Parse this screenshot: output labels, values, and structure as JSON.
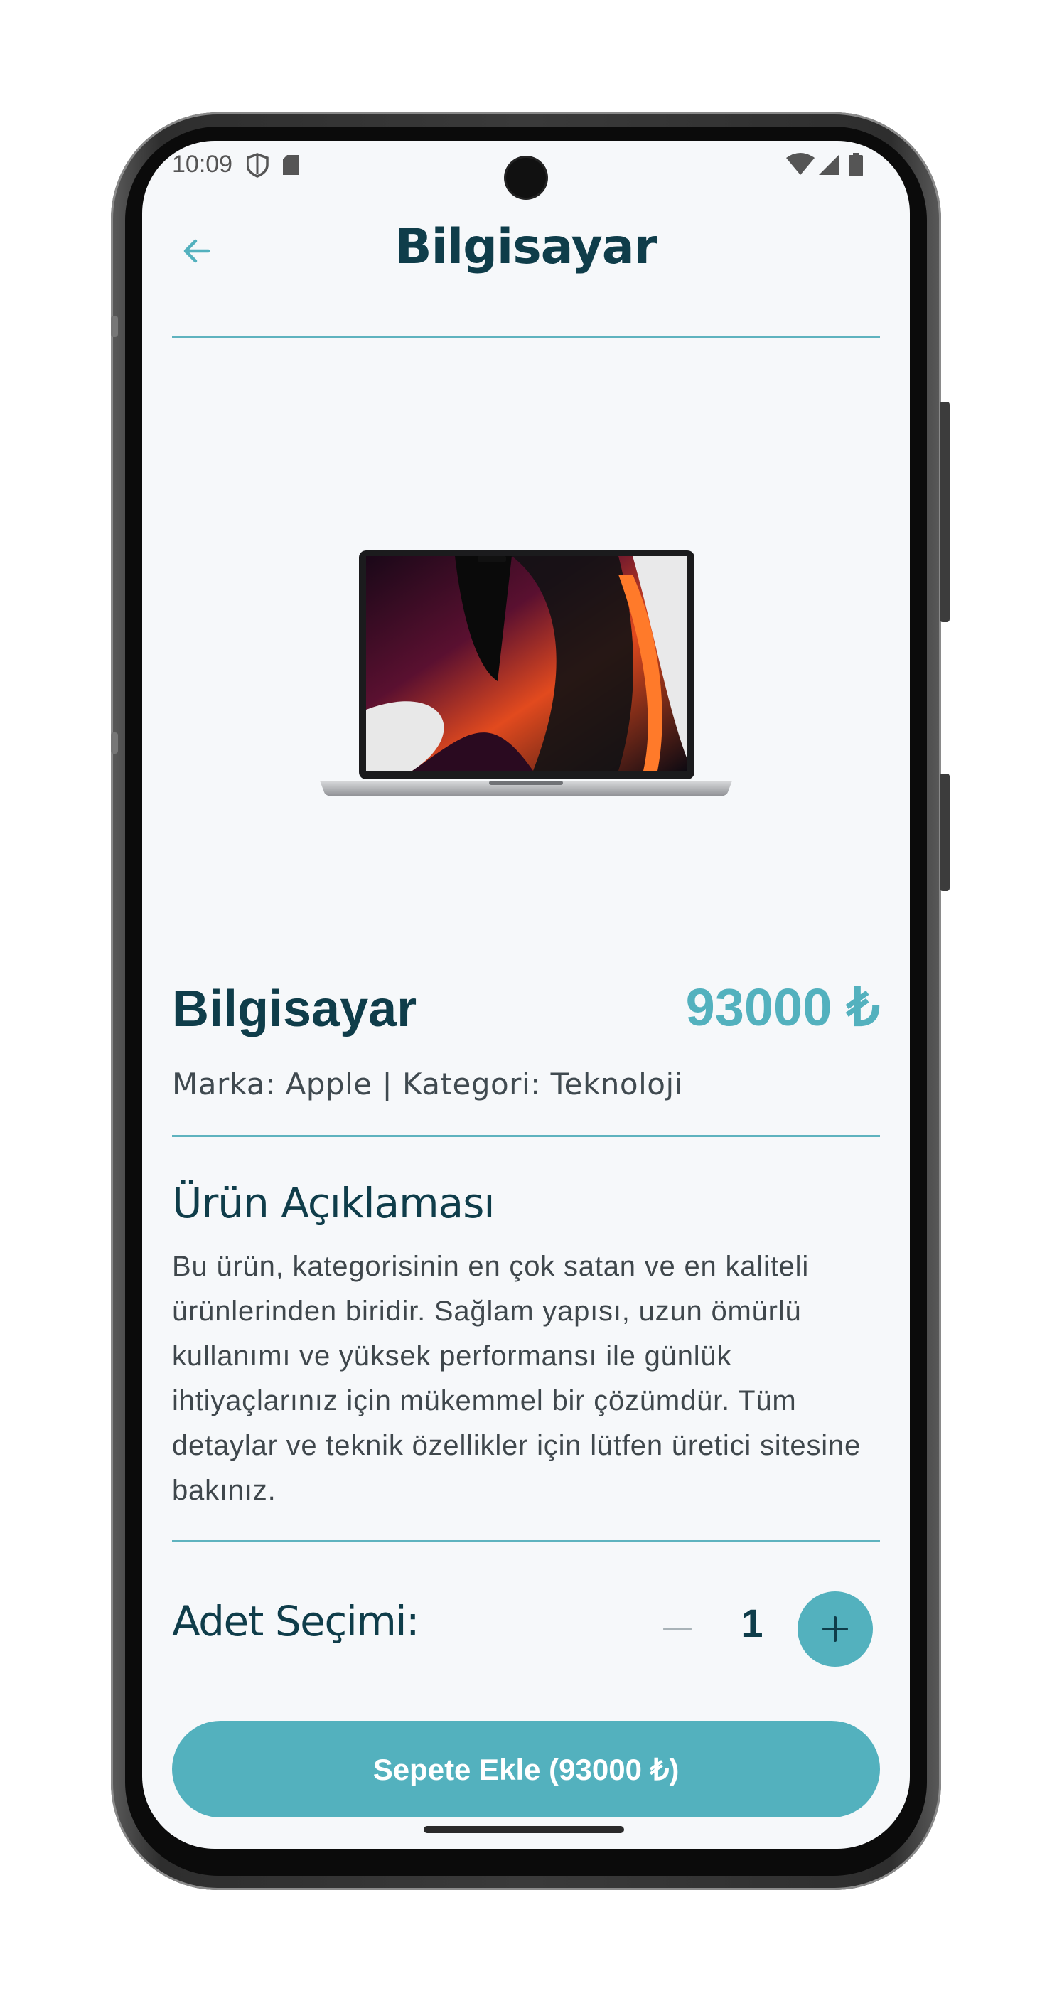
{
  "status_bar": {
    "time": "10:09"
  },
  "header": {
    "title": "Bilgisayar"
  },
  "product": {
    "name": "Bilgisayar",
    "price": "93000 ₺",
    "meta": "Marka: Apple | Kategori: Teknoloji"
  },
  "description": {
    "title": "Ürün Açıklaması",
    "text": "Bu ürün, kategorisinin en çok satan ve en kaliteli ürünlerinden biridir. Sağlam yapısı, uzun ömürlü kullanımı ve yüksek performansı ile günlük ihtiyaçlarınız için mükemmel bir çözümdür. Tüm detaylar ve teknik özellikler için lütfen üretici sitesine bakınız."
  },
  "quantity": {
    "label": "Adet Seçimi:",
    "value": "1"
  },
  "cart_button": {
    "label": "Sepete Ekle (93000 ₺)"
  },
  "colors": {
    "primary": "#53b1be",
    "heading": "#0f3d4a",
    "background": "#f6f8fa"
  }
}
